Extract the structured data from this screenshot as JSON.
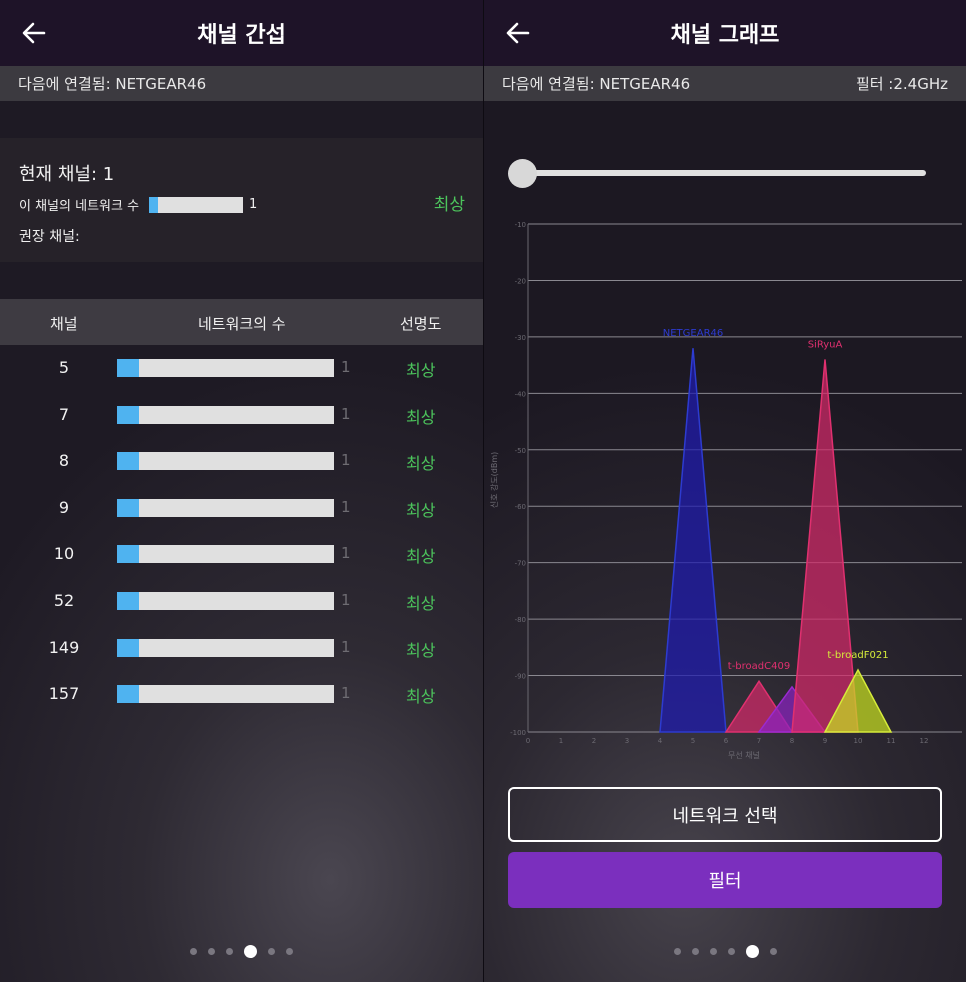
{
  "left": {
    "title": "채널 간섭",
    "connected": "다음에 연결됨: NETGEAR46",
    "current": {
      "title": "현재 채널: 1",
      "networks_label": "이 채널의 네트워크 수",
      "networks_count": "1",
      "networks_fill": 0.1,
      "quality": "최상",
      "recommended_label": "권장 채널:"
    },
    "table": {
      "headers": [
        "채널",
        "네트워크의 수",
        "선명도"
      ],
      "rows": [
        {
          "channel": "5",
          "count": "1",
          "fill": 0.1,
          "quality": "최상"
        },
        {
          "channel": "7",
          "count": "1",
          "fill": 0.1,
          "quality": "최상"
        },
        {
          "channel": "8",
          "count": "1",
          "fill": 0.1,
          "quality": "최상"
        },
        {
          "channel": "9",
          "count": "1",
          "fill": 0.1,
          "quality": "최상"
        },
        {
          "channel": "10",
          "count": "1",
          "fill": 0.1,
          "quality": "최상"
        },
        {
          "channel": "52",
          "count": "1",
          "fill": 0.1,
          "quality": "최상"
        },
        {
          "channel": "149",
          "count": "1",
          "fill": 0.1,
          "quality": "최상"
        },
        {
          "channel": "157",
          "count": "1",
          "fill": 0.1,
          "quality": "최상"
        }
      ]
    },
    "page_dots": 6,
    "active_dot": 3
  },
  "right": {
    "title": "채널 그래프",
    "connected": "다음에 연결됨: NETGEAR46",
    "filter": "필터 :2.4GHz",
    "slider_value": 0,
    "select_button": "네트워크 선택",
    "filter_button": "필터",
    "page_dots": 6,
    "active_dot": 4
  },
  "colors": {
    "accent": "#7b2fbe",
    "quality_good": "#4cc45c",
    "bar_fill": "#4fb3f0"
  },
  "chart_data": {
    "type": "area",
    "xlabel": "무선 채널",
    "ylabel": "신호 강도(dBm)",
    "xlim": [
      0,
      13
    ],
    "ylim": [
      -100,
      -10
    ],
    "x_ticks": [
      0,
      1,
      2,
      3,
      4,
      5,
      6,
      7,
      8,
      9,
      10,
      11,
      12
    ],
    "y_ticks": [
      -10,
      -20,
      -30,
      -40,
      -50,
      -60,
      -70,
      -80,
      -90,
      -100
    ],
    "grid": true,
    "series": [
      {
        "name": "NETGEAR46",
        "channel": 5,
        "peak": -32,
        "width": 1.0,
        "color": "#1f1ab0",
        "label_color": "#2d3bd0"
      },
      {
        "name": "t-broadC409",
        "channel": 7,
        "peak": -91,
        "width": 1.0,
        "color": "#d42a6a",
        "label_color": "#e0306f"
      },
      {
        "name": "",
        "channel": 8,
        "peak": -92,
        "width": 1.0,
        "color": "#8a22c0",
        "label_color": "#9a2ad0"
      },
      {
        "name": "SiRyuA",
        "channel": 9,
        "peak": -34,
        "width": 1.0,
        "color": "#d42a6a",
        "label_color": "#e0306f"
      },
      {
        "name": "t-broadF021",
        "channel": 10,
        "peak": -89,
        "width": 1.0,
        "color": "#c8e020",
        "label_color": "#d6ec3a"
      }
    ]
  }
}
